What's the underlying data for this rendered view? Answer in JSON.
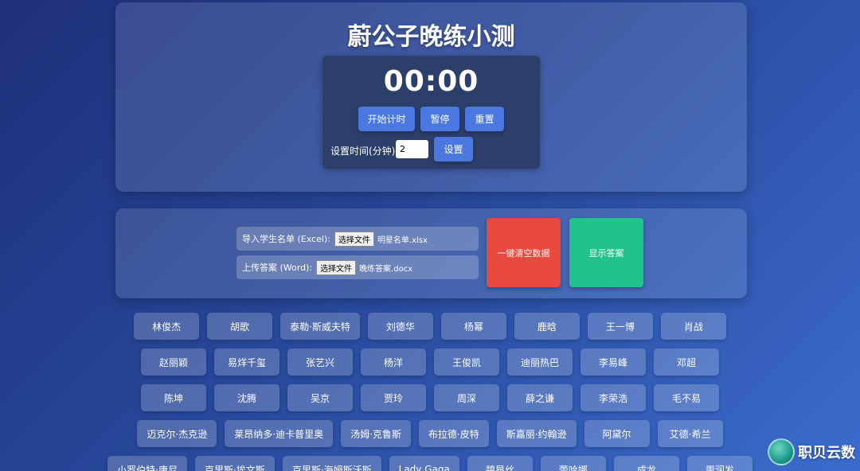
{
  "header": {
    "title": "蔚公子晚练小测"
  },
  "timer": {
    "display": "00:00",
    "start_label": "开始计时",
    "pause_label": "暂停",
    "reset_label": "重置",
    "set_time_label": "设置时间(分钟):",
    "minutes_value": "2",
    "set_label": "设置"
  },
  "upload": {
    "excel_label": "导入学生名单 (Excel):",
    "excel_button": "选择文件",
    "excel_file": "明星名单.xlsx",
    "word_label": "上传答案 (Word):",
    "word_button": "选择文件",
    "word_file": "晚练答案.docx"
  },
  "actions": {
    "clear_label": "一键清空数据",
    "show_answer_label": "显示答案"
  },
  "names": {
    "row1": [
      "林俊杰",
      "胡歌",
      "泰勒·斯威夫特",
      "刘德华",
      "杨幂",
      "鹿晗",
      "王一博",
      "肖战"
    ],
    "row2": [
      "赵丽颖",
      "易烊千玺",
      "张艺兴",
      "杨洋",
      "王俊凯",
      "迪丽热巴",
      "李易峰",
      "邓超"
    ],
    "row3": [
      "陈坤",
      "沈腾",
      "吴京",
      "贾玲",
      "周深",
      "薛之谦",
      "李荣浩",
      "毛不易"
    ],
    "row4": [
      "迈克尔·杰克逊",
      "莱昂纳多·迪卡普里奥",
      "汤姆·克鲁斯",
      "布拉德·皮特",
      "斯嘉丽·约翰逊",
      "阿黛尔",
      "艾德·希兰"
    ],
    "row5": [
      "小罗伯特·唐尼",
      "克里斯·埃文斯",
      "克里斯·海姆斯沃斯",
      "Lady Gaga",
      "碧昂丝",
      "蕾哈娜",
      "成龙",
      "周润发"
    ]
  },
  "watermark": {
    "text": "职贝云数"
  },
  "colors": {
    "accent": "#4a78e0",
    "danger": "#e8493f",
    "success": "#20c48a"
  }
}
